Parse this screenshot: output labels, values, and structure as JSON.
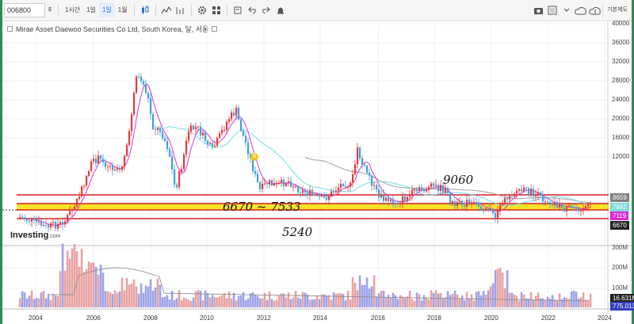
{
  "toolbar": {
    "symbol": "006800",
    "symbol_dropdown": "$",
    "intervals": [
      {
        "label": "1시간",
        "active": false
      },
      {
        "label": "1일",
        "active": false
      },
      {
        "label": "1일",
        "active": true
      },
      {
        "label": "1월",
        "active": false
      }
    ],
    "right_label": "기본제도"
  },
  "chart": {
    "title": "Mirae Asset Daewoo Securities Co Ltd, South Korea, 달, 서울",
    "y_ticks": [
      "40000",
      "36000",
      "32000",
      "28000",
      "24000",
      "20000",
      "16000",
      "12000"
    ],
    "volume_ticks": [
      "300M",
      "200M",
      "100M"
    ],
    "x_ticks": [
      "2004",
      "2006",
      "2008",
      "2010",
      "2012",
      "2014",
      "2016",
      "2018",
      "2020",
      "2022",
      "2024"
    ],
    "price_tags": [
      {
        "value": "8659",
        "color": "#808080"
      },
      {
        "value": "7692",
        "color": "#7ed9d9"
      },
      {
        "value": "7119",
        "color": "#d62ad6"
      },
      {
        "value": "6670",
        "color": "#222222"
      }
    ],
    "volume_tags": [
      {
        "value": "16.631M",
        "color": "#222222"
      },
      {
        "value": "775.013",
        "color": "#3040c0"
      }
    ],
    "annotations": {
      "range_text": "6670 ~ 7533",
      "upper_text": "9060",
      "lower_text": "5240"
    },
    "dividend_marker": "$",
    "logo_main": "Investing",
    "logo_suffix": ".com"
  }
}
